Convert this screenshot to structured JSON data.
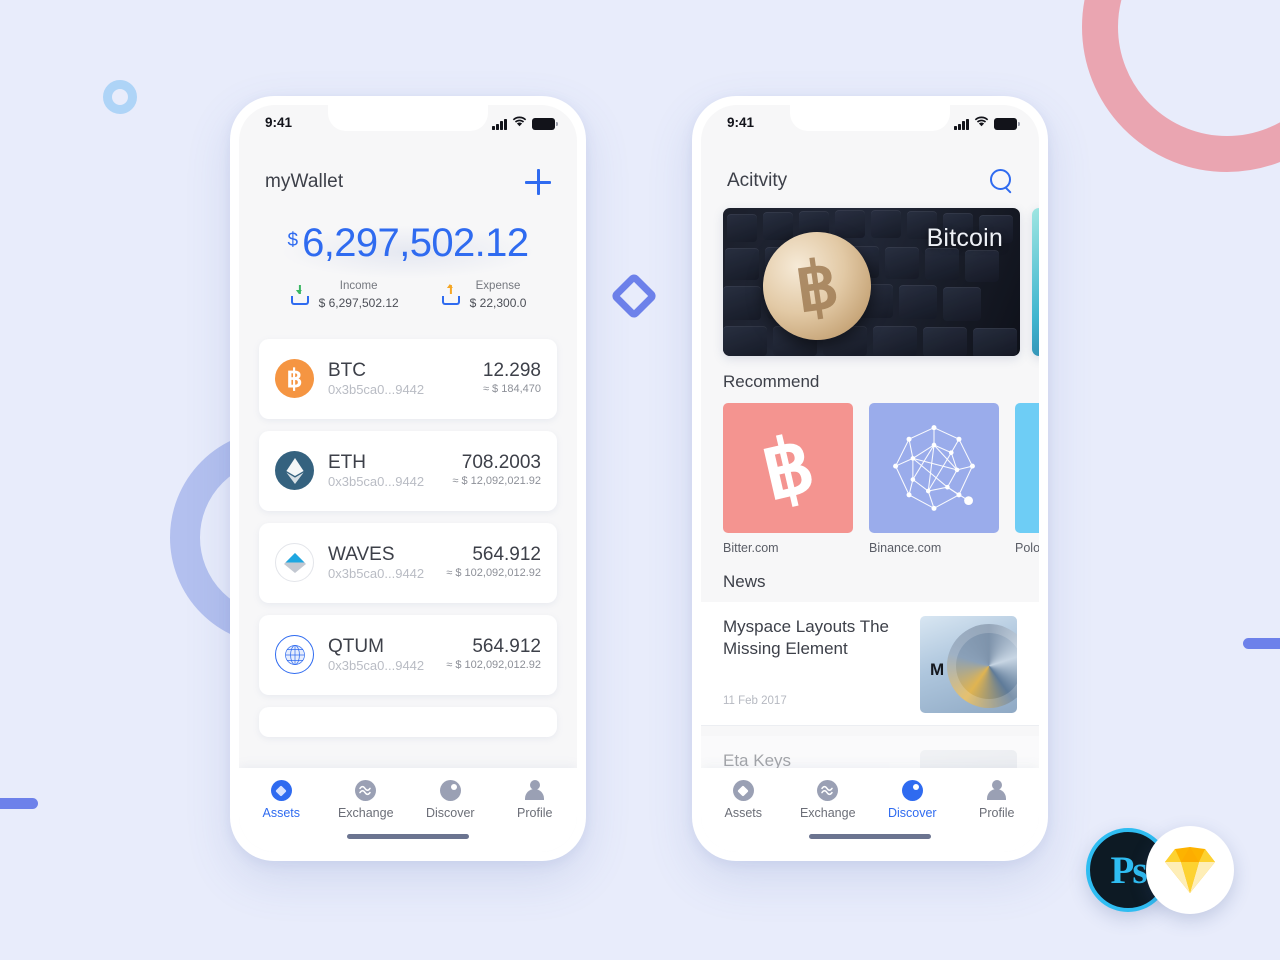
{
  "theme": {
    "background": "#e8ecfb",
    "accent_blue": "#2f6bf0",
    "periwinkle": "#6d81ea",
    "pink_arc": "#eaa5b1",
    "light_blue_ring": "#aed4f7"
  },
  "phone1": {
    "status": {
      "time": "9:41",
      "signal_icon": "cellular-signal-icon",
      "wifi_icon": "wifi-icon",
      "battery_icon": "battery-icon"
    },
    "header": {
      "title": "myWallet",
      "add_icon": "plus-icon"
    },
    "balance": {
      "currency_symbol": "$",
      "amount": "6,297,502.12"
    },
    "summary": [
      {
        "icon": "income-tray-down-icon",
        "label": "Income",
        "value": "$ 6,297,502.12"
      },
      {
        "icon": "expense-tray-up-icon",
        "label": "Expense",
        "value": "$ 22,300.0"
      }
    ],
    "assets": [
      {
        "icon": "btc-coin-icon",
        "symbol": "BTC",
        "address": "0x3b5ca0...9442",
        "amount": "12.298",
        "usd": "≈ $ 184,470"
      },
      {
        "icon": "eth-coin-icon",
        "symbol": "ETH",
        "address": "0x3b5ca0...9442",
        "amount": "708.2003",
        "usd": "≈ $ 12,092,021.92"
      },
      {
        "icon": "waves-coin-icon",
        "symbol": "WAVES",
        "address": "0x3b5ca0...9442",
        "amount": "564.912",
        "usd": "≈ $ 102,092,012.92"
      },
      {
        "icon": "qtum-coin-icon",
        "symbol": "QTUM",
        "address": "0x3b5ca0...9442",
        "amount": "564.912",
        "usd": "≈ $ 102,092,012.92"
      }
    ],
    "tabs": [
      {
        "icon": "assets-diamond-icon",
        "label": "Assets",
        "active": true
      },
      {
        "icon": "exchange-wave-icon",
        "label": "Exchange",
        "active": false
      },
      {
        "icon": "discover-compass-icon",
        "label": "Discover",
        "active": false
      },
      {
        "icon": "profile-person-icon",
        "label": "Profile",
        "active": false
      }
    ]
  },
  "phone2": {
    "status": {
      "time": "9:41",
      "signal_icon": "cellular-signal-icon",
      "wifi_icon": "wifi-icon",
      "battery_icon": "battery-icon"
    },
    "header": {
      "title": "Acitvity",
      "search_icon": "search-icon"
    },
    "banners": [
      {
        "image": "bitcoin-coin-on-keyboard-photo",
        "caption": "Bitcoin"
      },
      {
        "image": "teal-abstract-photo",
        "caption": ""
      }
    ],
    "recommend": {
      "title": "Recommend",
      "items": [
        {
          "icon": "bitcoin-b-icon",
          "label": "Bitter.com",
          "color": "#f49490"
        },
        {
          "icon": "binance-network-icon",
          "label": "Binance.com",
          "color": "#9aaceb"
        },
        {
          "icon": "poloniex-icon",
          "label": "Polone",
          "color": "#6ecdf5"
        }
      ]
    },
    "news": {
      "title": "News",
      "items": [
        {
          "title": "Myspace Layouts The Missing Element",
          "date": "11 Feb 2017",
          "thumb": "ibm-disk-drive-photo"
        },
        {
          "title": "Eta Keys",
          "date": "",
          "thumb": "person-avatar-photo"
        }
      ]
    },
    "tabs": [
      {
        "icon": "assets-diamond-icon",
        "label": "Assets",
        "active": false
      },
      {
        "icon": "exchange-wave-icon",
        "label": "Exchange",
        "active": false
      },
      {
        "icon": "discover-compass-icon",
        "label": "Discover",
        "active": true
      },
      {
        "icon": "profile-person-icon",
        "label": "Profile",
        "active": false
      }
    ]
  },
  "badges": {
    "photoshop": {
      "icon": "photoshop-logo",
      "label": "Ps"
    },
    "sketch": {
      "icon": "sketch-logo",
      "label": ""
    }
  }
}
